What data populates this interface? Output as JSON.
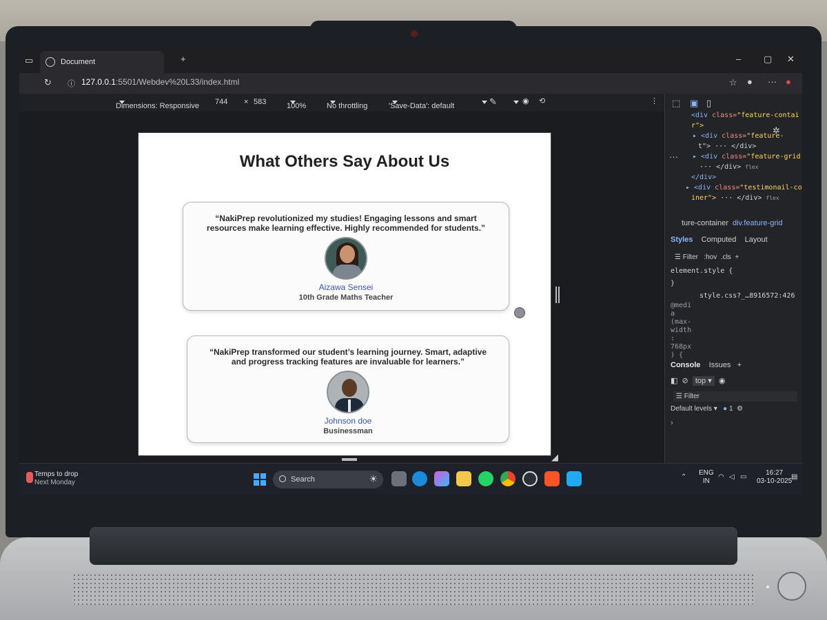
{
  "browser": {
    "tab_title": "Document",
    "url_host": "127.0.0.1",
    "url_port_path": ":5501/Webdev%20L33/index.html"
  },
  "responsive_bar": {
    "dimensions_label": "Dimensions: Responsive",
    "width": "744",
    "times": "×",
    "height": "583",
    "zoom": "100%",
    "throttling": "No throttling",
    "save_data": "'Save-Data': default"
  },
  "page": {
    "title": "What Others Say About Us",
    "testimonials": [
      {
        "quote": "“NakiPrep revolutionized my studies! Engaging lessons and smart resources make learning effective. Highly recommended for students.”",
        "name": "Aizawa Sensei",
        "role": "10th Grade Maths Teacher"
      },
      {
        "quote": "“NakiPrep transformed our student’s learning journey. Smart, adaptive and progress tracking features are invaluable for learners.”",
        "name": "Johnson doe",
        "role": "Businessman"
      }
    ]
  },
  "devtools": {
    "dom_lines": {
      "l1_tag": "<div",
      "l1_attr": "class=",
      "l1_val": "\"feature-contai",
      "l1b": "r\">",
      "l2_attr": "class=",
      "l2_val": "\"feature-",
      "l2b": "t\"> ··· </div>",
      "l3_attr": "class=",
      "l3_val": "\"feature-grid",
      "l3b": "··· </div>",
      "l3_badge": "flex",
      "l4": "</div>",
      "l5_attr": "class=",
      "l5_val": "\"testimonail-co",
      "l5b": "iner\">",
      "l5c": "··· </div>",
      "l5_badge": "flex"
    },
    "breadcrumb_1": "ture-container",
    "breadcrumb_2": "div.feature-grid",
    "tabs": {
      "styles": "Styles",
      "computed": "Computed",
      "layout": "Layout"
    },
    "filter": "Filter",
    "hov": ":hov",
    "cls": ".cls",
    "element_style": "element.style {",
    "close_brace": "}",
    "css_source": "style.css?_…8916572:426",
    "media_rule": "@medi\na\n(max-\nwidth\n:\n768px\n) {",
    "console_tabs": {
      "console": "Console",
      "issues": "Issues"
    },
    "context": "top",
    "console_filter": "Filter",
    "default_levels": "Default levels",
    "issue_count": "1",
    "prompt": "›"
  },
  "taskbar": {
    "weather_title": "Temps to drop",
    "weather_sub": "Next Monday",
    "search_placeholder": "Search",
    "lang_1": "ENG",
    "lang_2": "IN",
    "time": "16:27",
    "date": "03-10-2025"
  }
}
